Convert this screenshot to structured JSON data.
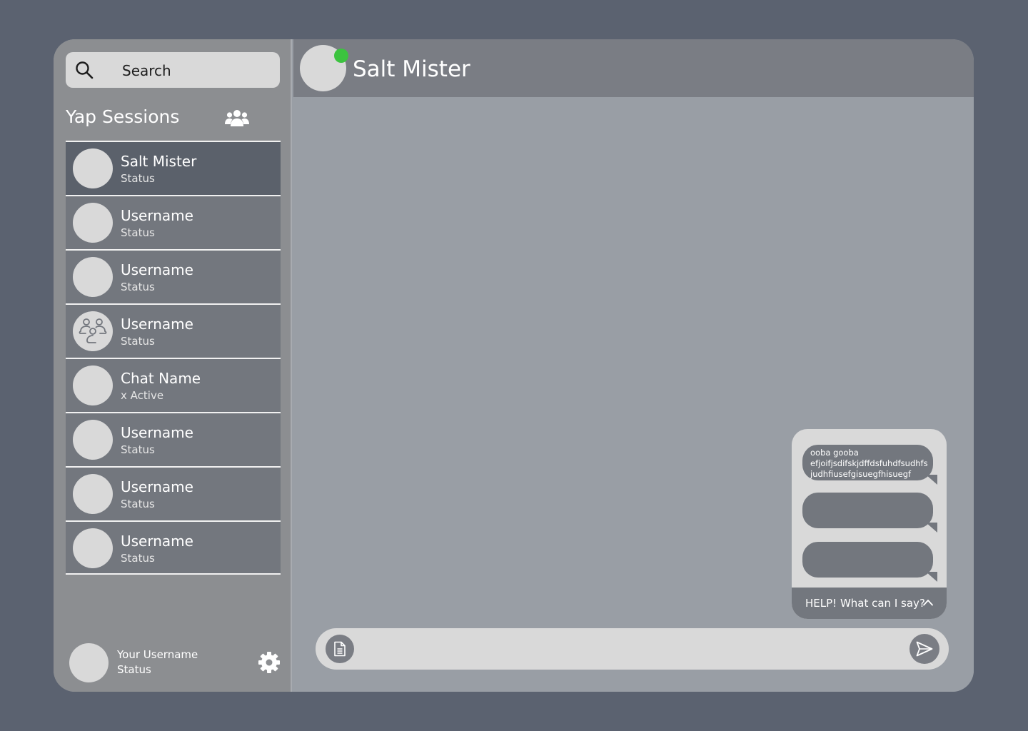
{
  "search": {
    "placeholder": "Search"
  },
  "sidebar": {
    "title": "Yap Sessions",
    "sessions": [
      {
        "name": "Salt Mister",
        "status": "Status",
        "active": true
      },
      {
        "name": "Username",
        "status": "Status"
      },
      {
        "name": "Username",
        "status": "Status"
      },
      {
        "name": "Username",
        "status": "Status",
        "group_avatar": true
      },
      {
        "name": "Chat Name",
        "status": "x Active"
      },
      {
        "name": "Username",
        "status": "Status"
      },
      {
        "name": "Username",
        "status": "Status"
      },
      {
        "name": "Username",
        "status": "Status"
      }
    ],
    "me": {
      "username": "Your Username",
      "status": "Status"
    }
  },
  "chat": {
    "contact_name": "Salt Mister",
    "online_color": "#3cc33f"
  },
  "help": {
    "suggestions": [
      "ooba gooba\nefjoifjsdifskjdffdsfuhdfsudhfs\njudhfiusefgisuegfhisuegf",
      "",
      ""
    ],
    "footer_label": "HELP! What can I say?"
  },
  "icons": {
    "search": "search-icon",
    "group": "group-icon",
    "settings": "gear-icon",
    "attach": "document-icon",
    "send": "send-icon",
    "chevron": "chevron-up-icon"
  }
}
